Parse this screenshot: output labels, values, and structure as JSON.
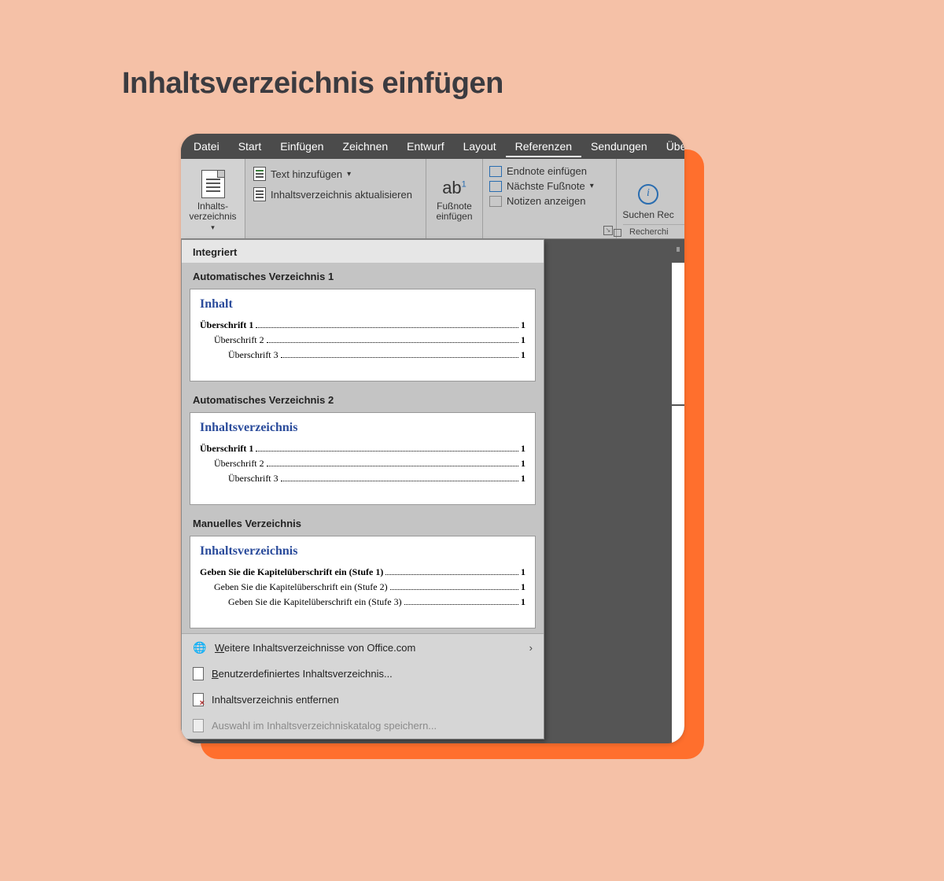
{
  "page_title": "Inhaltsverzeichnis einfügen",
  "menubar": {
    "tabs": [
      "Datei",
      "Start",
      "Einfügen",
      "Zeichnen",
      "Entwurf",
      "Layout",
      "Referenzen",
      "Sendungen",
      "Übe"
    ],
    "active_index": 6
  },
  "ribbon": {
    "toc_button": {
      "line1": "Inhalts-",
      "line2": "verzeichnis"
    },
    "add_text": "Text hinzufügen",
    "update_toc": "Inhaltsverzeichnis aktualisieren",
    "footnote": {
      "line1": "Fußnote",
      "line2": "einfügen",
      "ab": "ab"
    },
    "endnote_insert": "Endnote einfügen",
    "next_footnote": "Nächste Fußnote",
    "show_notes": "Notizen anzeigen",
    "search": "Suchen",
    "rec": "Rec",
    "research_label": "Recherchi"
  },
  "dropdown": {
    "header": "Integriert",
    "sections": [
      {
        "title": "Automatisches Verzeichnis 1",
        "preview": {
          "toc_title": "Inhalt",
          "lines": [
            {
              "level": 1,
              "label": "Überschrift 1",
              "page": "1",
              "bold": true
            },
            {
              "level": 2,
              "label": "Überschrift 2",
              "page": "1"
            },
            {
              "level": 3,
              "label": "Überschrift 3",
              "page": "1"
            }
          ]
        }
      },
      {
        "title": "Automatisches Verzeichnis 2",
        "preview": {
          "toc_title": "Inhaltsverzeichnis",
          "lines": [
            {
              "level": 1,
              "label": "Überschrift 1",
              "page": "1",
              "bold": true
            },
            {
              "level": 2,
              "label": "Überschrift 2",
              "page": "1"
            },
            {
              "level": 3,
              "label": "Überschrift 3",
              "page": "1"
            }
          ]
        }
      },
      {
        "title": "Manuelles Verzeichnis",
        "preview": {
          "toc_title": "Inhaltsverzeichnis",
          "lines": [
            {
              "level": 1,
              "label": "Geben Sie die Kapitelüberschrift ein (Stufe 1)",
              "page": "1",
              "bold": true
            },
            {
              "level": 2,
              "label": "Geben Sie die Kapitelüberschrift ein (Stufe 2)",
              "page": "1"
            },
            {
              "level": 3,
              "label": "Geben Sie die Kapitelüberschrift ein (Stufe 3)",
              "page": "1"
            }
          ]
        }
      }
    ],
    "menu": {
      "more_office": "Weitere Inhaltsverzeichnisse von Office.com",
      "custom": "Benutzerdefiniertes Inhaltsverzeichnis...",
      "remove": "Inhaltsverzeichnis entfernen",
      "save_selection": "Auswahl im Inhaltsverzeichniskatalog speichern..."
    }
  }
}
